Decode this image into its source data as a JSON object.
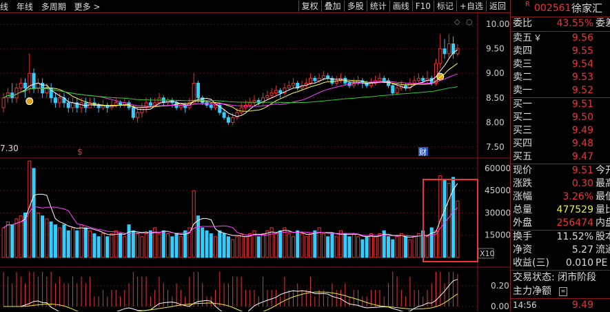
{
  "toolbar": {
    "left_items": [
      "线",
      "年线",
      "多周期",
      "更多 >"
    ],
    "right_items": [
      "复权",
      "叠加",
      "多股",
      "统计",
      "画线",
      "F10",
      "标记",
      "+自选",
      "返回"
    ]
  },
  "main_chart": {
    "y_ticks": [
      "10.00",
      "9.50",
      "9.00",
      "8.50",
      "8.00",
      "7.50"
    ],
    "low_label": "7.30",
    "marker_s": "$",
    "marker_cai": "财",
    "corner_icon": "◇",
    "corner_icon2": "○"
  },
  "volume_chart": {
    "y_ticks": [
      "60000",
      "45000",
      "30000",
      "15000"
    ],
    "unit": "X10"
  },
  "indicator_chart": {
    "y_ticks": [
      "0.20",
      "0.00"
    ]
  },
  "chart_data": {
    "type": "candlestick",
    "candles": [
      [
        8.3,
        8.5,
        8.6,
        8.2
      ],
      [
        8.5,
        8.6,
        8.7,
        8.4
      ],
      [
        8.6,
        8.5,
        8.8,
        8.4
      ],
      [
        8.5,
        8.7,
        8.8,
        8.4
      ],
      [
        8.7,
        8.8,
        8.9,
        8.6
      ],
      [
        8.8,
        8.7,
        8.9,
        8.5
      ],
      [
        8.7,
        9.0,
        9.4,
        8.6
      ],
      [
        9.0,
        8.7,
        9.1,
        8.6
      ],
      [
        8.7,
        8.8,
        8.9,
        8.6
      ],
      [
        8.8,
        8.6,
        8.9,
        8.5
      ],
      [
        8.6,
        8.7,
        8.8,
        8.5
      ],
      [
        8.7,
        8.5,
        8.8,
        8.4
      ],
      [
        8.5,
        8.4,
        8.6,
        8.3
      ],
      [
        8.4,
        8.5,
        8.6,
        8.3
      ],
      [
        8.5,
        8.4,
        8.6,
        8.3
      ],
      [
        8.4,
        8.3,
        8.5,
        8.2
      ],
      [
        8.3,
        8.4,
        8.5,
        8.2
      ],
      [
        8.4,
        8.3,
        8.5,
        8.2
      ],
      [
        8.3,
        8.4,
        8.5,
        8.2
      ],
      [
        8.4,
        8.3,
        8.5,
        8.2
      ],
      [
        8.3,
        8.4,
        8.5,
        8.3
      ],
      [
        8.4,
        8.35,
        8.5,
        8.3
      ],
      [
        8.35,
        8.3,
        8.4,
        8.2
      ],
      [
        8.3,
        8.35,
        8.45,
        8.25
      ],
      [
        8.35,
        8.3,
        8.4,
        8.2
      ],
      [
        8.3,
        8.35,
        8.45,
        8.25
      ],
      [
        8.35,
        8.4,
        8.5,
        8.3
      ],
      [
        8.4,
        8.35,
        8.45,
        8.3
      ],
      [
        8.35,
        8.4,
        8.5,
        8.3
      ],
      [
        8.4,
        8.3,
        8.45,
        8.25
      ],
      [
        8.3,
        8.1,
        8.35,
        8.05
      ],
      [
        8.1,
        8.2,
        8.3,
        8.0
      ],
      [
        8.2,
        8.3,
        8.4,
        8.1
      ],
      [
        8.3,
        8.4,
        8.5,
        8.2
      ],
      [
        8.4,
        8.35,
        8.5,
        8.3
      ],
      [
        8.35,
        8.4,
        8.5,
        8.3
      ],
      [
        8.4,
        8.5,
        8.6,
        8.35
      ],
      [
        8.5,
        8.4,
        8.55,
        8.35
      ],
      [
        8.4,
        8.45,
        8.5,
        8.35
      ],
      [
        8.45,
        8.4,
        8.5,
        8.3
      ],
      [
        8.4,
        8.3,
        8.45,
        8.25
      ],
      [
        8.3,
        8.35,
        8.4,
        8.25
      ],
      [
        8.35,
        8.3,
        8.4,
        8.2
      ],
      [
        8.3,
        8.4,
        8.5,
        8.25
      ],
      [
        8.4,
        8.8,
        9.0,
        8.35
      ],
      [
        8.8,
        8.5,
        8.85,
        8.4
      ],
      [
        8.5,
        8.4,
        8.55,
        8.35
      ],
      [
        8.4,
        8.35,
        8.45,
        8.3
      ],
      [
        8.35,
        8.3,
        8.4,
        8.25
      ],
      [
        8.3,
        8.35,
        8.4,
        8.25
      ],
      [
        8.35,
        8.2,
        8.4,
        8.15
      ],
      [
        8.2,
        8.1,
        8.25,
        8.05
      ],
      [
        8.1,
        8.0,
        8.15,
        7.95
      ],
      [
        8.0,
        8.1,
        8.2,
        7.95
      ],
      [
        8.1,
        8.2,
        8.3,
        8.05
      ],
      [
        8.2,
        8.3,
        8.4,
        8.15
      ],
      [
        8.3,
        8.35,
        8.45,
        8.25
      ],
      [
        8.35,
        8.4,
        8.5,
        8.3
      ],
      [
        8.4,
        8.45,
        8.55,
        8.35
      ],
      [
        8.45,
        8.4,
        8.5,
        8.35
      ],
      [
        8.4,
        8.5,
        8.6,
        8.35
      ],
      [
        8.5,
        8.55,
        8.65,
        8.45
      ],
      [
        8.55,
        8.6,
        8.7,
        8.5
      ],
      [
        8.6,
        8.65,
        8.75,
        8.55
      ],
      [
        8.65,
        8.6,
        8.7,
        8.5
      ],
      [
        8.6,
        8.7,
        8.8,
        8.55
      ],
      [
        8.7,
        8.75,
        8.85,
        8.65
      ],
      [
        8.75,
        8.8,
        8.9,
        8.7
      ],
      [
        8.8,
        8.7,
        8.85,
        8.65
      ],
      [
        8.7,
        8.75,
        8.85,
        8.65
      ],
      [
        8.75,
        8.8,
        8.9,
        8.7
      ],
      [
        8.8,
        8.9,
        9.0,
        8.75
      ],
      [
        8.9,
        8.85,
        8.95,
        8.8
      ],
      [
        8.85,
        8.9,
        9.0,
        8.8
      ],
      [
        8.9,
        8.95,
        9.05,
        8.85
      ],
      [
        8.95,
        8.9,
        9.0,
        8.85
      ],
      [
        8.9,
        8.8,
        8.95,
        8.75
      ],
      [
        8.8,
        8.85,
        8.95,
        8.75
      ],
      [
        8.85,
        8.9,
        9.0,
        8.8
      ],
      [
        8.9,
        8.8,
        8.95,
        8.75
      ],
      [
        8.8,
        8.75,
        8.85,
        8.7
      ],
      [
        8.75,
        8.8,
        8.9,
        8.7
      ],
      [
        8.8,
        8.85,
        8.95,
        8.75
      ],
      [
        8.85,
        8.8,
        8.9,
        8.7
      ],
      [
        8.8,
        8.75,
        8.85,
        8.7
      ],
      [
        8.75,
        8.8,
        8.9,
        8.7
      ],
      [
        8.8,
        8.85,
        8.95,
        8.75
      ],
      [
        8.85,
        8.9,
        9.0,
        8.8
      ],
      [
        8.9,
        8.85,
        8.95,
        8.8
      ],
      [
        8.85,
        8.75,
        8.9,
        8.7
      ],
      [
        8.75,
        8.6,
        8.8,
        8.55
      ],
      [
        8.6,
        8.7,
        8.8,
        8.55
      ],
      [
        8.7,
        8.75,
        8.85,
        8.65
      ],
      [
        8.75,
        8.7,
        8.8,
        8.65
      ],
      [
        8.7,
        8.8,
        8.9,
        8.65
      ],
      [
        8.8,
        8.85,
        8.95,
        8.75
      ],
      [
        8.85,
        8.9,
        9.0,
        8.8
      ],
      [
        8.9,
        8.85,
        8.95,
        8.8
      ],
      [
        8.85,
        8.9,
        9.05,
        8.8
      ],
      [
        8.9,
        8.8,
        8.95,
        8.75
      ],
      [
        8.8,
        9.2,
        9.3,
        8.75
      ],
      [
        9.2,
        9.5,
        9.8,
        9.1
      ],
      [
        9.5,
        9.4,
        9.7,
        9.3
      ],
      [
        9.4,
        9.6,
        9.8,
        9.3
      ],
      [
        9.6,
        9.4,
        9.75,
        9.3
      ],
      [
        9.4,
        9.51,
        9.6,
        9.35
      ]
    ],
    "volumes": [
      20,
      24,
      22,
      26,
      28,
      30,
      65,
      60,
      30,
      28,
      26,
      24,
      22,
      20,
      22,
      18,
      20,
      18,
      22,
      20,
      18,
      16,
      14,
      16,
      14,
      16,
      18,
      16,
      14,
      22,
      18,
      16,
      14,
      16,
      18,
      20,
      16,
      18,
      16,
      14,
      16,
      14,
      18,
      20,
      45,
      28,
      20,
      18,
      16,
      14,
      18,
      16,
      14,
      12,
      14,
      16,
      14,
      16,
      18,
      14,
      16,
      18,
      20,
      16,
      18,
      20,
      16,
      14,
      18,
      16,
      14,
      16,
      18,
      20,
      16,
      14,
      16,
      14,
      18,
      16,
      14,
      16,
      14,
      12,
      14,
      16,
      14,
      16,
      18,
      14,
      12,
      14,
      16,
      14,
      12,
      14,
      16,
      18,
      14,
      20,
      18,
      55,
      52,
      50,
      54,
      38
    ],
    "y_range": [
      7.3,
      10.2
    ],
    "vol_range": [
      0,
      66000
    ]
  },
  "quote_panel": {
    "r_label": "R",
    "code": "002561",
    "name": "徐家汇",
    "weibi_label": "委比",
    "weibi_value": "43.55%",
    "weibi_cut": "委差",
    "sell": [
      {
        "label": "卖五",
        "price": "9.56",
        "yen": "￥"
      },
      {
        "label": "卖四",
        "price": "9.55",
        "yen": ""
      },
      {
        "label": "卖三",
        "price": "9.54",
        "yen": ""
      },
      {
        "label": "卖二",
        "price": "9.53",
        "yen": ""
      },
      {
        "label": "卖一",
        "price": "9.52",
        "yen": ""
      }
    ],
    "buy": [
      {
        "label": "买一",
        "price": "9.51"
      },
      {
        "label": "买二",
        "price": "9.50"
      },
      {
        "label": "买三",
        "price": "9.49"
      },
      {
        "label": "买四",
        "price": "9.48"
      },
      {
        "label": "买五",
        "price": "9.47"
      }
    ],
    "stats1": [
      {
        "label": "现价",
        "value": "9.51",
        "cut": "今开"
      },
      {
        "label": "涨跌",
        "value": "0.30",
        "cut": "最高"
      },
      {
        "label": "涨幅",
        "value": "3.26%",
        "cut": "最低"
      },
      {
        "label": "总量",
        "value": "477529",
        "cut": "量比"
      },
      {
        "label": "外盘",
        "value": "256474",
        "cut": "内盘"
      }
    ],
    "stats2": [
      {
        "label": "换手",
        "value": "11.52%",
        "cut": "股本"
      },
      {
        "label": "净资",
        "value": "5.27",
        "cut": "流通"
      },
      {
        "label": "收益(三)",
        "value": "0.010",
        "cut": "PE"
      }
    ],
    "trade_status": "交易状态: 闭市阶段",
    "main_net_label": "主力净额",
    "bottom_time": "14:56",
    "bottom_price": "9.49",
    "colors": {
      "up": "#ee3333",
      "down": "#33ccff",
      "ma5": "#ffffff",
      "ma10": "#ffff44",
      "ma20": "#ff44ff",
      "ma60": "#33cc33",
      "border": "#8b1a1a"
    }
  }
}
